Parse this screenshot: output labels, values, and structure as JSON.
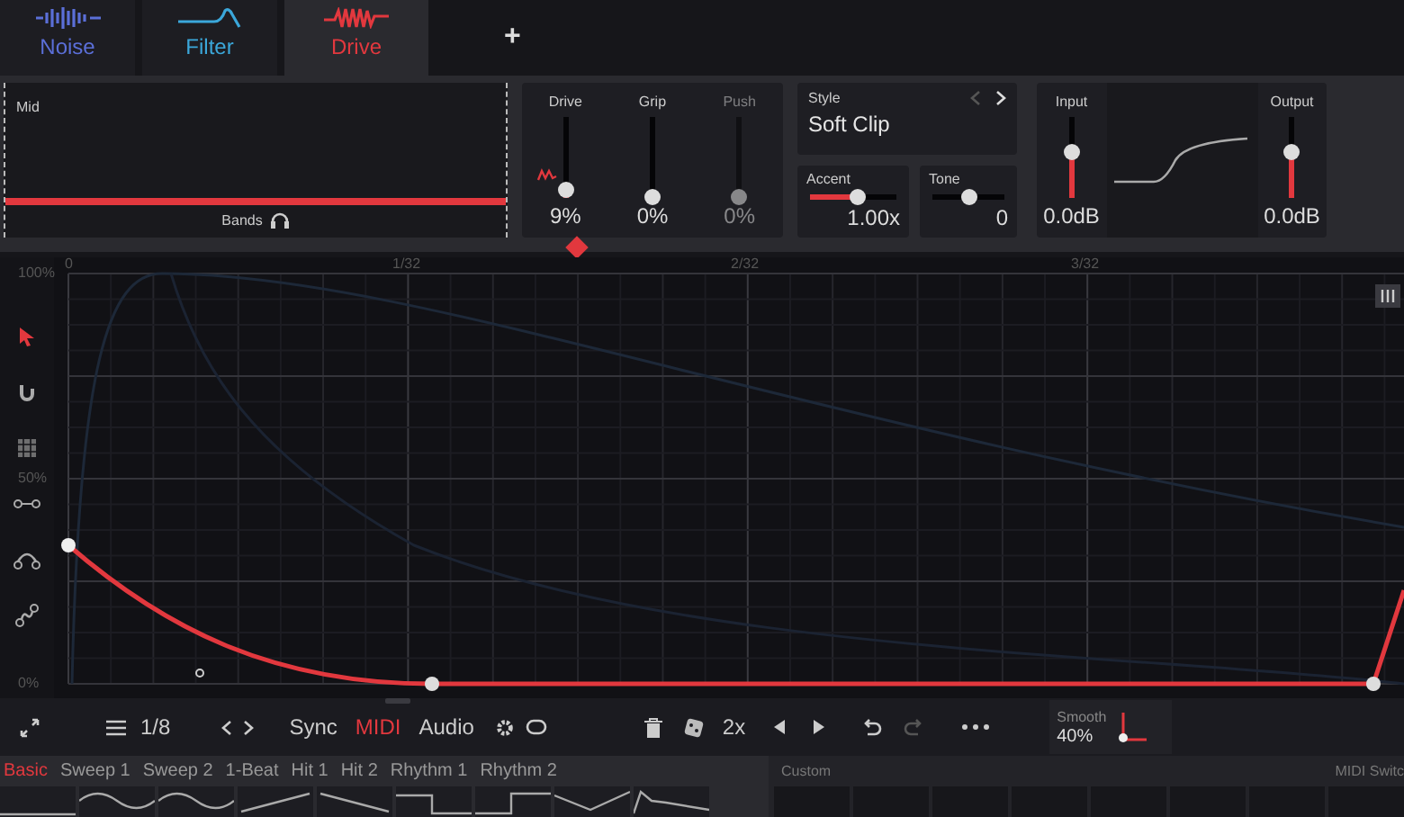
{
  "tabs": [
    {
      "label": "Noise",
      "kind": "noise",
      "color": "#5b6fd8",
      "selected": false
    },
    {
      "label": "Filter",
      "kind": "filter",
      "color": "#3ba7da",
      "selected": false
    },
    {
      "label": "Drive",
      "kind": "drive",
      "color": "#e2383e",
      "selected": true
    }
  ],
  "add_tab": "+",
  "band": {
    "label": "Mid",
    "footer": "Bands"
  },
  "drive_sliders": [
    {
      "label": "Drive",
      "value": "9%",
      "level": 0.1,
      "disabled": false
    },
    {
      "label": "Grip",
      "value": "0%",
      "level": 0,
      "disabled": false
    },
    {
      "label": "Push",
      "value": "0%",
      "level": 0,
      "disabled": true
    }
  ],
  "style": {
    "label": "Style",
    "value": "Soft Clip"
  },
  "accent": {
    "label": "Accent",
    "value": "1.00x",
    "level": 0.55,
    "filled": true
  },
  "tone": {
    "label": "Tone",
    "value": "0",
    "level": 0.5,
    "filled": false
  },
  "input": {
    "label": "Input",
    "value": "0.0dB",
    "level": 0.55
  },
  "output": {
    "label": "Output",
    "value": "0.0dB",
    "level": 0.55
  },
  "tools": [
    {
      "kind": "pointer",
      "selected": true
    },
    {
      "kind": "magnet",
      "selected": false
    },
    {
      "kind": "grid",
      "selected": false
    },
    {
      "kind": "line",
      "selected": false
    },
    {
      "kind": "arc",
      "selected": false
    },
    {
      "kind": "scurve",
      "selected": false
    }
  ],
  "y_labels": [
    "100%",
    "50%",
    "0%"
  ],
  "x_labels": [
    "0",
    "1/32",
    "2/32",
    "3/32"
  ],
  "toolbar": {
    "grid": "1/8",
    "modes": [
      {
        "label": "Sync",
        "selected": false
      },
      {
        "label": "MIDI",
        "selected": true
      },
      {
        "label": "Audio",
        "selected": false
      }
    ],
    "speed": "2x",
    "smooth_label": "Smooth",
    "smooth_value": "40%"
  },
  "presets": [
    {
      "label": "Basic",
      "selected": true
    },
    {
      "label": "Sweep 1",
      "selected": false
    },
    {
      "label": "Sweep 2",
      "selected": false
    },
    {
      "label": "1-Beat",
      "selected": false
    },
    {
      "label": "Hit 1",
      "selected": false
    },
    {
      "label": "Hit 2",
      "selected": false
    },
    {
      "label": "Rhythm 1",
      "selected": false
    },
    {
      "label": "Rhythm 2",
      "selected": false
    }
  ],
  "thumbnails": [
    {
      "kind": "flat"
    },
    {
      "kind": "sine"
    },
    {
      "kind": "sine"
    },
    {
      "kind": "rampup"
    },
    {
      "kind": "rampdown"
    },
    {
      "kind": "stepdown"
    },
    {
      "kind": "stepup"
    },
    {
      "kind": "triangle"
    },
    {
      "kind": "decay"
    }
  ],
  "sections": [
    "Custom",
    "MIDI Switc"
  ]
}
